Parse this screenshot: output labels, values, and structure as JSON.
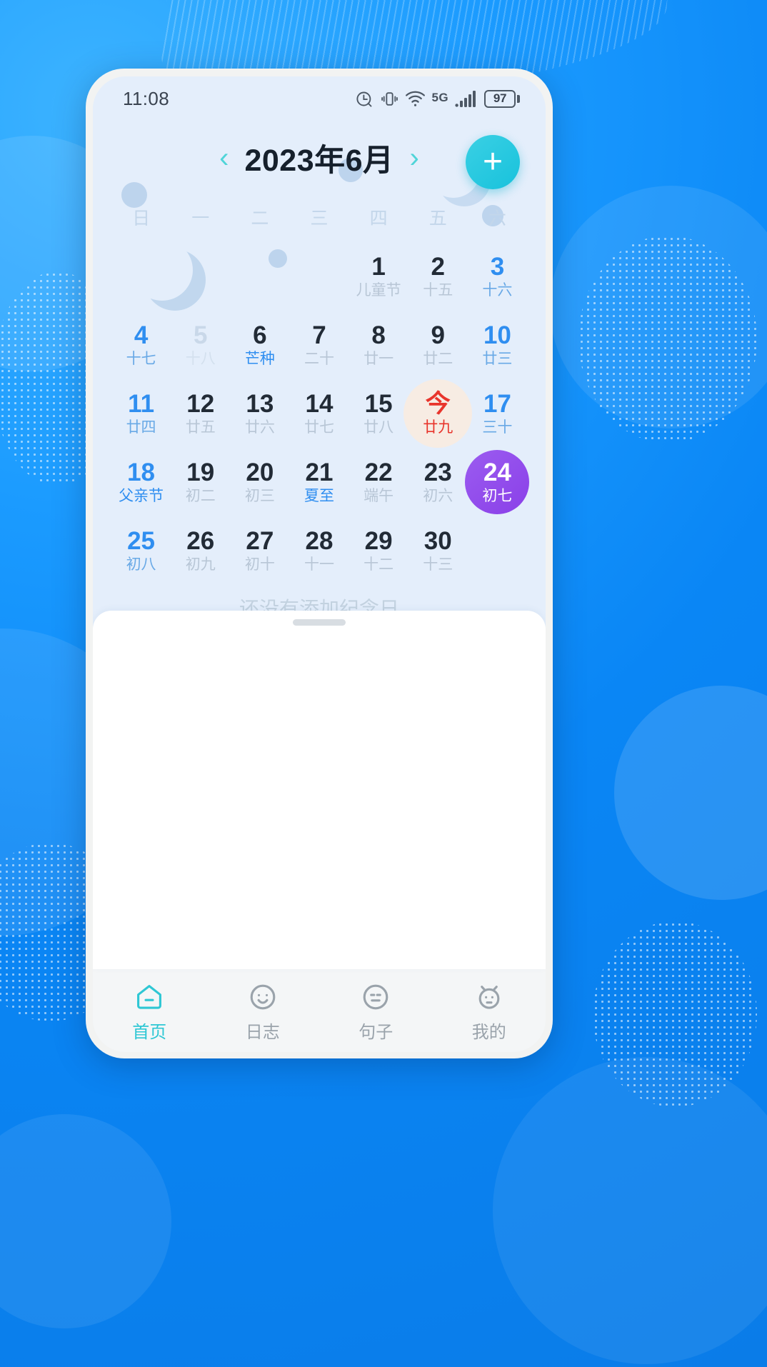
{
  "statusbar": {
    "time": "11:08",
    "icons": [
      "alarm-icon",
      "vibrate-icon",
      "wifi-icon",
      "signal-icon"
    ],
    "network_label": "5G",
    "battery_percent": "97"
  },
  "calendar": {
    "prev_label": "‹",
    "next_label": "›",
    "title": "2023年6月",
    "add_label": "+",
    "weekdays": [
      "日",
      "一",
      "二",
      "三",
      "四",
      "五",
      "六"
    ],
    "empty_note": "还没有添加纪念日",
    "accent_today_color": "#e8352c",
    "accent_selected_color": "#8a3fe8",
    "accent_weekend_color": "#2f8ef0",
    "accent_chevron_color": "#4fd4d8",
    "cells": [
      {
        "num": "",
        "sub": "",
        "type": "blank"
      },
      {
        "num": "",
        "sub": "",
        "type": "blank"
      },
      {
        "num": "",
        "sub": "",
        "type": "blank"
      },
      {
        "num": "",
        "sub": "",
        "type": "blank"
      },
      {
        "num": "1",
        "sub": "儿童节",
        "type": "weekday"
      },
      {
        "num": "2",
        "sub": "十五",
        "type": "weekday"
      },
      {
        "num": "3",
        "sub": "十六",
        "type": "weekend"
      },
      {
        "num": "4",
        "sub": "十七",
        "type": "weekend"
      },
      {
        "num": "5",
        "sub": "十八",
        "type": "dim"
      },
      {
        "num": "6",
        "sub": "芒种",
        "type": "weekday",
        "sub_class": "term"
      },
      {
        "num": "7",
        "sub": "二十",
        "type": "weekday"
      },
      {
        "num": "8",
        "sub": "廿一",
        "type": "weekday"
      },
      {
        "num": "9",
        "sub": "廿二",
        "type": "weekday"
      },
      {
        "num": "10",
        "sub": "廿三",
        "type": "weekend"
      },
      {
        "num": "11",
        "sub": "廿四",
        "type": "weekend"
      },
      {
        "num": "12",
        "sub": "廿五",
        "type": "weekday"
      },
      {
        "num": "13",
        "sub": "廿六",
        "type": "weekday"
      },
      {
        "num": "14",
        "sub": "廿七",
        "type": "weekday"
      },
      {
        "num": "15",
        "sub": "廿八",
        "type": "weekday"
      },
      {
        "num": "今",
        "sub": "廿九",
        "type": "today"
      },
      {
        "num": "17",
        "sub": "三十",
        "type": "weekend"
      },
      {
        "num": "18",
        "sub": "父亲节",
        "type": "weekend",
        "sub_class": "festival"
      },
      {
        "num": "19",
        "sub": "初二",
        "type": "weekday"
      },
      {
        "num": "20",
        "sub": "初三",
        "type": "weekday"
      },
      {
        "num": "21",
        "sub": "夏至",
        "type": "weekday",
        "sub_class": "term"
      },
      {
        "num": "22",
        "sub": "端午",
        "type": "weekday"
      },
      {
        "num": "23",
        "sub": "初六",
        "type": "weekday"
      },
      {
        "num": "24",
        "sub": "初七",
        "type": "selected"
      },
      {
        "num": "25",
        "sub": "初八",
        "type": "weekend"
      },
      {
        "num": "26",
        "sub": "初九",
        "type": "weekday"
      },
      {
        "num": "27",
        "sub": "初十",
        "type": "weekday"
      },
      {
        "num": "28",
        "sub": "十一",
        "type": "weekday"
      },
      {
        "num": "29",
        "sub": "十二",
        "type": "weekday"
      },
      {
        "num": "30",
        "sub": "十三",
        "type": "weekday"
      },
      {
        "num": "",
        "sub": "",
        "type": "blank"
      }
    ]
  },
  "tabbar": {
    "active_color": "#2ec7d4",
    "inactive_color": "#9aa3ab",
    "items": [
      {
        "label": "首页",
        "icon": "home-icon",
        "active": true
      },
      {
        "label": "日志",
        "icon": "journal-icon",
        "active": false
      },
      {
        "label": "句子",
        "icon": "quote-icon",
        "active": false
      },
      {
        "label": "我的",
        "icon": "profile-icon",
        "active": false
      }
    ]
  }
}
